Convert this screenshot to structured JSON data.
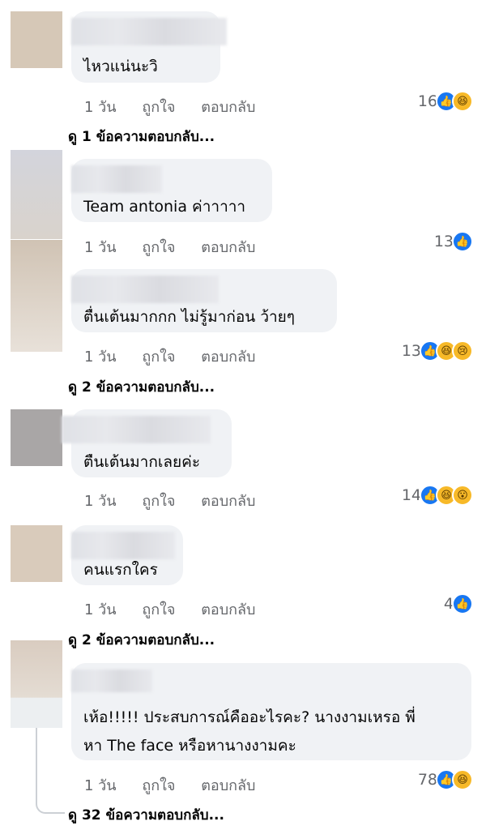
{
  "comments": [
    {
      "text": "ไหวแน่นะวิ",
      "time": "1 วัน",
      "like": "ถูกใจ",
      "reply": "ตอบกลับ",
      "count": "16",
      "reactions": [
        "like-icon",
        "haha-icon"
      ],
      "replies_link": "ดู 1 ข้อความตอบกลับ..."
    },
    {
      "text": "Team antonia ค่าาาาา",
      "time": "1 วัน",
      "like": "ถูกใจ",
      "reply": "ตอบกลับ",
      "count": "13",
      "reactions": [
        "like-icon"
      ]
    },
    {
      "text": "ตื่นเต้นมากกก ไม่รู้มาก่อน ว้ายๆ",
      "time": "1 วัน",
      "like": "ถูกใจ",
      "reply": "ตอบกลับ",
      "count": "13",
      "reactions": [
        "like-icon",
        "haha-icon",
        "sad-icon"
      ],
      "replies_link": "ดู 2 ข้อความตอบกลับ..."
    },
    {
      "text": "ตืนเต้นมากเลยค่ะ",
      "time": "1 วัน",
      "like": "ถูกใจ",
      "reply": "ตอบกลับ",
      "count": "14",
      "reactions": [
        "like-icon",
        "haha-icon",
        "wow-icon"
      ]
    },
    {
      "text": "คนแรกใคร",
      "time": "1 วัน",
      "like": "ถูกใจ",
      "reply": "ตอบกลับ",
      "count": "4",
      "reactions": [
        "like-icon"
      ],
      "replies_link": "ดู 2 ข้อความตอบกลับ..."
    },
    {
      "text_line1": "เห้อ!!!!! ประสบการณ์คืออะไรคะ? นางงามเหรอ พี่",
      "text_line2": "หา The face หรือหานางงามคะ",
      "time": "1 วัน",
      "like": "ถูกใจ",
      "reply": "ตอบกลับ",
      "count": "78",
      "reactions": [
        "like-icon",
        "haha-icon"
      ],
      "replies_link": "ดู 32 ข้อความตอบกลับ..."
    }
  ],
  "colors": {
    "bubble": "#f0f2f5",
    "like": "#1877f2",
    "emoji": "#f7b928",
    "meta": "#65676b"
  }
}
